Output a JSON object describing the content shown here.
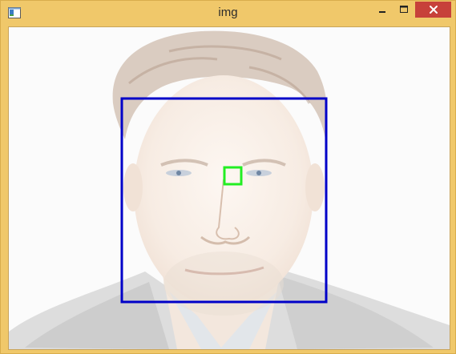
{
  "window": {
    "title": "img",
    "icons": {
      "app": "window-app-icon",
      "minimize": "minimize-icon",
      "maximize": "maximize-icon",
      "close": "close-icon"
    }
  },
  "image": {
    "subject": "face photo",
    "detections": [
      {
        "label": "face-box",
        "color": "#0000c8"
      },
      {
        "label": "feature-box",
        "color": "#22ee22"
      }
    ]
  },
  "colors": {
    "titlebar": "#f0c86a",
    "close_button": "#c7413a",
    "face_box": "#0000c8",
    "feature_box": "#22ee22"
  }
}
